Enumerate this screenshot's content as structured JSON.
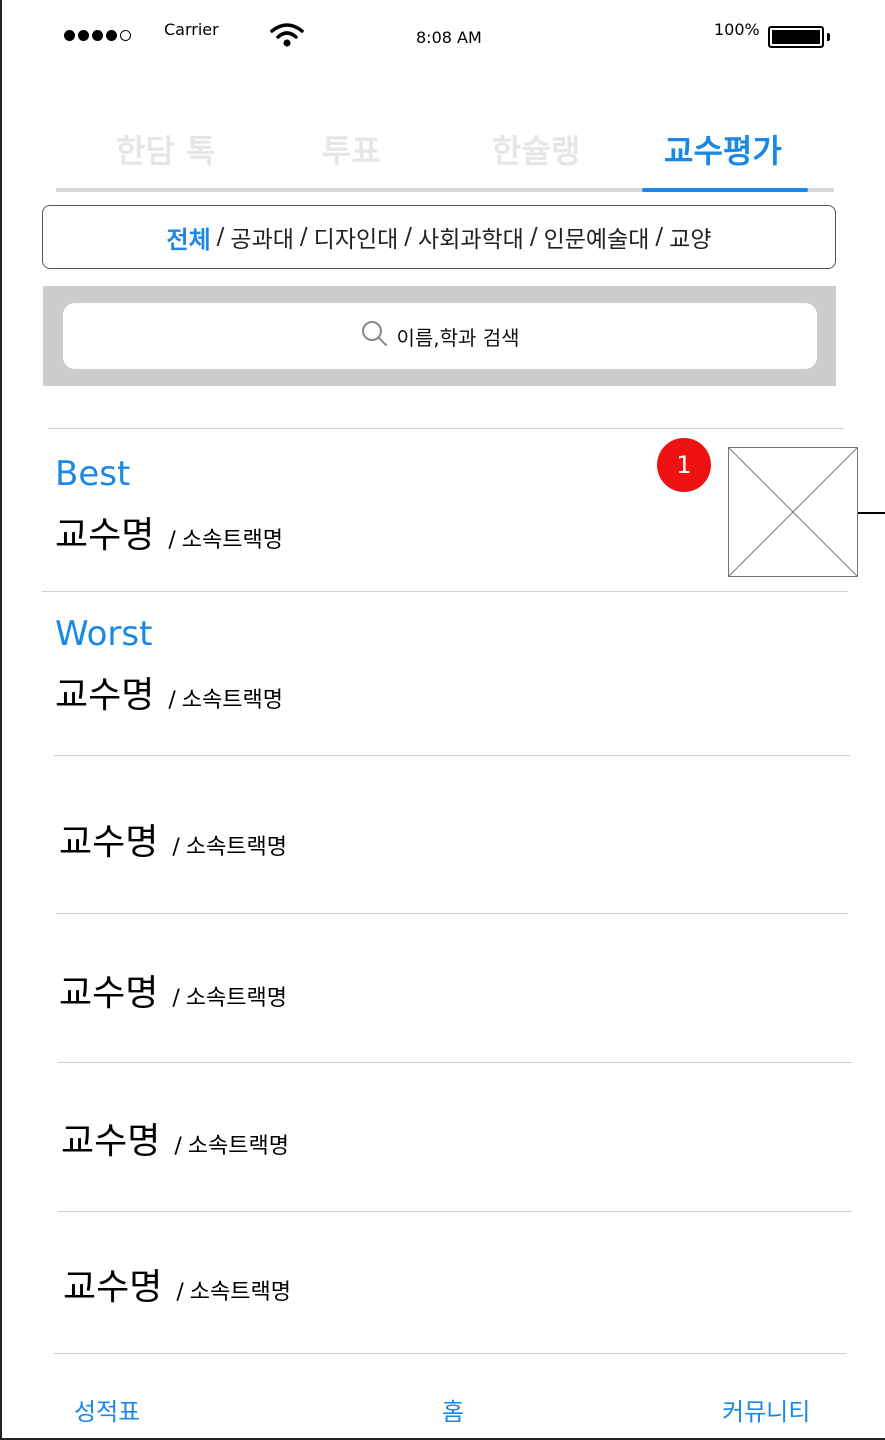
{
  "status_bar": {
    "carrier": "Carrier",
    "time": "8:08 AM",
    "battery": "100%",
    "signal_icon": "signal-dots-icon",
    "wifi_icon": "wifi-icon",
    "battery_icon": "battery-icon"
  },
  "tabs": {
    "items": [
      {
        "label": "한담 톡"
      },
      {
        "label": "투표"
      },
      {
        "label": "한슐랭"
      },
      {
        "label": "교수평가"
      }
    ],
    "active_index": 3
  },
  "filter": {
    "selected": "전체",
    "items": [
      "공과대",
      "디자인대",
      "사회과학대",
      "인문예술대",
      "교양"
    ],
    "separator": "/"
  },
  "search": {
    "placeholder": "이름,학과 검색",
    "icon": "search-icon"
  },
  "list": {
    "rows": [
      {
        "label": "Best",
        "name": "교수명",
        "slash": "/",
        "track": "소속트랙명"
      },
      {
        "label": "Worst",
        "name": "교수명",
        "slash": "/",
        "track": "소속트랙명"
      },
      {
        "name": "교수명",
        "slash": "/",
        "track": "소속트랙명"
      },
      {
        "name": "교수명",
        "slash": "/",
        "track": "소속트랙명"
      },
      {
        "name": "교수명",
        "slash": "/",
        "track": "소속트랙명"
      },
      {
        "name": "교수명",
        "slash": "/",
        "track": "소속트랙명"
      }
    ]
  },
  "annotation": {
    "badge": "1",
    "image_placeholder_icon": "image-placeholder-icon"
  },
  "bottom_nav": {
    "items": [
      {
        "label": "성적표"
      },
      {
        "label": "홈"
      },
      {
        "label": "커뮤니티"
      }
    ]
  },
  "colors": {
    "accent": "#1a88e6",
    "inactive_tab": "#e6e6e6",
    "search_bg": "#cccccd",
    "badge": "#ee1111"
  }
}
